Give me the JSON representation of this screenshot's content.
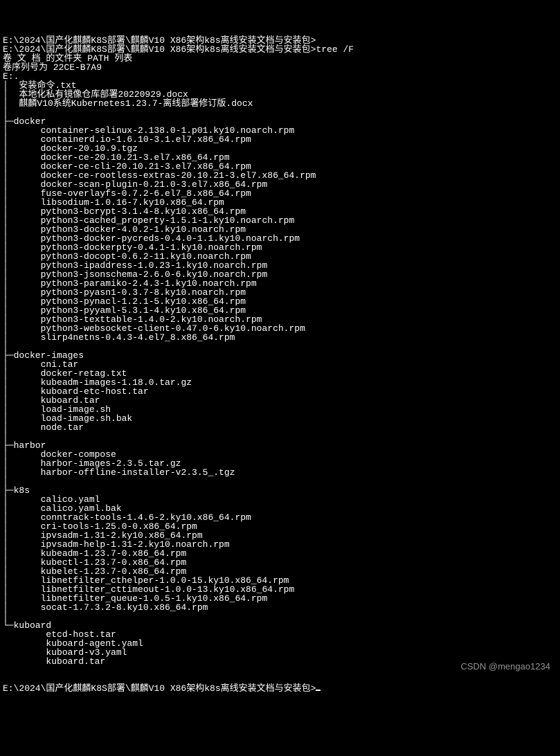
{
  "prompt1": "E:\\2024\\国产化麒麟K8S部署\\麒麟V10 X86架构k8s离线安装文档与安装包>",
  "command1": "tree /F",
  "header1": "卷 文 档 的文件夹 PATH 列表",
  "header2": "卷序列号为 22CE-B7A9",
  "root": "E:.",
  "rootFiles": [
    "安装命令.txt",
    "本地化私有镜像仓库部署20220929.docx",
    "麒麟V10系统Kubernetes1.23.7-离线部署修订版.docx"
  ],
  "dirs": [
    {
      "name": "docker",
      "files": [
        "container-selinux-2.138.0-1.p01.ky10.noarch.rpm",
        "containerd.io-1.6.10-3.1.el7.x86_64.rpm",
        "docker-20.10.9.tgz",
        "docker-ce-20.10.21-3.el7.x86_64.rpm",
        "docker-ce-cli-20.10.21-3.el7.x86_64.rpm",
        "docker-ce-rootless-extras-20.10.21-3.el7.x86_64.rpm",
        "docker-scan-plugin-0.21.0-3.el7.x86_64.rpm",
        "fuse-overlayfs-0.7.2-6.el7_8.x86_64.rpm",
        "libsodium-1.0.16-7.ky10.x86_64.rpm",
        "python3-bcrypt-3.1.4-8.ky10.x86_64.rpm",
        "python3-cached_property-1.5.1-1.ky10.noarch.rpm",
        "python3-docker-4.0.2-1.ky10.noarch.rpm",
        "python3-docker-pycreds-0.4.0-1.1.ky10.noarch.rpm",
        "python3-dockerpty-0.4.1-1.ky10.noarch.rpm",
        "python3-docopt-0.6.2-11.ky10.noarch.rpm",
        "python3-ipaddress-1.0.23-1.ky10.noarch.rpm",
        "python3-jsonschema-2.6.0-6.ky10.noarch.rpm",
        "python3-paramiko-2.4.3-1.ky10.noarch.rpm",
        "python3-pyasn1-0.3.7-8.ky10.noarch.rpm",
        "python3-pynacl-1.2.1-5.ky10.x86_64.rpm",
        "python3-pyyaml-5.3.1-4.ky10.x86_64.rpm",
        "python3-texttable-1.4.0-2.ky10.noarch.rpm",
        "python3-websocket-client-0.47.0-6.ky10.noarch.rpm",
        "slirp4netns-0.4.3-4.el7_8.x86_64.rpm"
      ]
    },
    {
      "name": "docker-images",
      "files": [
        "cni.tar",
        "docker-retag.txt",
        "kubeadm-images-1.18.0.tar.gz",
        "kuboard-etc-host.tar",
        "kuboard.tar",
        "load-image.sh",
        "load-image.sh.bak",
        "node.tar"
      ]
    },
    {
      "name": "harbor",
      "files": [
        "docker-compose",
        "harbor-images-2.3.5.tar.gz",
        "harbor-offline-installer-v2.3.5_.tgz"
      ]
    },
    {
      "name": "k8s",
      "files": [
        "calico.yaml",
        "calico.yaml.bak",
        "conntrack-tools-1.4.6-2.ky10.x86_64.rpm",
        "cri-tools-1.25.0-0.x86_64.rpm",
        "ipvsadm-1.31-2.ky10.x86_64.rpm",
        "ipvsadm-help-1.31-2.ky10.noarch.rpm",
        "kubeadm-1.23.7-0.x86_64.rpm",
        "kubectl-1.23.7-0.x86_64.rpm",
        "kubelet-1.23.7-0.x86_64.rpm",
        "libnetfilter_cthelper-1.0.0-15.ky10.x86_64.rpm",
        "libnetfilter_cttimeout-1.0.0-13.ky10.x86_64.rpm",
        "libnetfilter_queue-1.0.5-1.ky10.x86_64.rpm",
        "socat-1.7.3.2-8.ky10.x86_64.rpm"
      ]
    },
    {
      "name": "kuboard",
      "files": [
        "etcd-host.tar",
        "kuboard-agent.yaml",
        "kuboard-v3.yaml",
        "kuboard.tar"
      ]
    }
  ],
  "prompt2": "E:\\2024\\国产化麒麟K8S部署\\麒麟V10 X86架构k8s离线安装文档与安装包>",
  "watermark": "CSDN @mengao1234"
}
